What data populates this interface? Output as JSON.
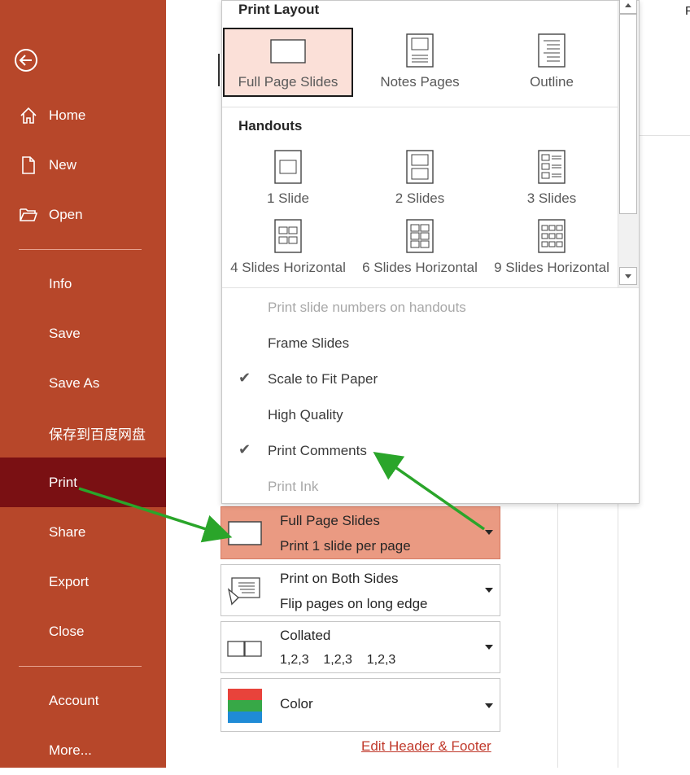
{
  "sidebar": {
    "back_icon": "back-arrow-icon",
    "items": [
      {
        "label": "Home",
        "icon": "home-icon"
      },
      {
        "label": "New",
        "icon": "new-document-icon"
      },
      {
        "label": "Open",
        "icon": "open-folder-icon"
      },
      {
        "label": "Info"
      },
      {
        "label": "Save"
      },
      {
        "label": "Save As"
      },
      {
        "label": "保存到百度网盘"
      },
      {
        "label": "Print",
        "selected": true
      },
      {
        "label": "Share"
      },
      {
        "label": "Export"
      },
      {
        "label": "Close"
      },
      {
        "label": "Account"
      },
      {
        "label": "More..."
      }
    ]
  },
  "preview_char": "P",
  "dropdown": {
    "print_layout_title": "Print Layout",
    "layouts": [
      {
        "label": "Full Page Slides",
        "selected": true
      },
      {
        "label": "Notes Pages"
      },
      {
        "label": "Outline"
      }
    ],
    "handouts_title": "Handouts",
    "handouts": [
      {
        "label": "1 Slide"
      },
      {
        "label": "2 Slides"
      },
      {
        "label": "3 Slides"
      },
      {
        "label": "4 Slides Horizontal"
      },
      {
        "label": "6 Slides Horizontal"
      },
      {
        "label": "9 Slides Horizontal"
      }
    ],
    "options": [
      {
        "label": "Print slide numbers on handouts",
        "enabled": false,
        "checked": false
      },
      {
        "label": "Frame Slides",
        "enabled": true,
        "checked": false
      },
      {
        "label": "Scale to Fit Paper",
        "enabled": true,
        "checked": true
      },
      {
        "label": "High Quality",
        "enabled": true,
        "checked": false
      },
      {
        "label": "Print Comments",
        "enabled": true,
        "checked": true
      },
      {
        "label": "Print Ink",
        "enabled": false,
        "checked": false
      }
    ]
  },
  "settings": {
    "layout": {
      "line1": "Full Page Slides",
      "line2": "Print 1 slide per page"
    },
    "sides": {
      "line1": "Print on Both Sides",
      "line2": "Flip pages on long edge"
    },
    "collate": {
      "line1": "Collated",
      "line2": "1,2,3    1,2,3    1,2,3"
    },
    "color": {
      "line1": "Color"
    }
  },
  "edit_header_footer": "Edit Header & Footer",
  "colors": {
    "sidebar_bg": "#b7472a",
    "sidebar_selected": "#7a1013",
    "active_setting": "#ea9a82",
    "selected_tile": "#fbe0d8",
    "annotation_arrow": "#2aa52a",
    "link": "#c0392b"
  }
}
